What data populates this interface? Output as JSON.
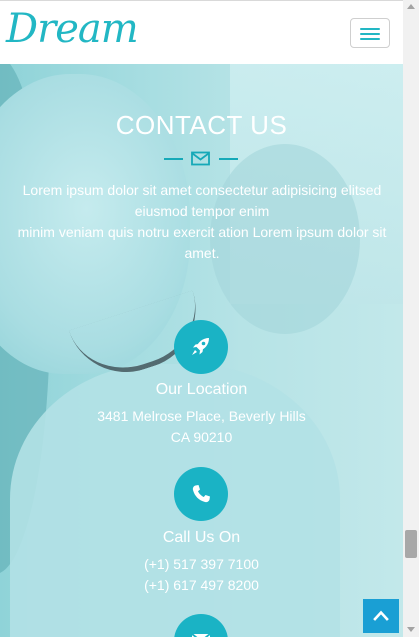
{
  "nav": {
    "brand": "Dream",
    "menu_icon": "hamburger-menu-icon"
  },
  "contact": {
    "title": "CONTACT US",
    "divider_icon": "envelope-icon",
    "lead_line1": "Lorem ipsum dolor sit amet consectetur adipisicing elitsed eiusmod tempor enim",
    "lead_line2": "minim veniam quis notru exercit ation Lorem ipsum dolor sit amet."
  },
  "location": {
    "icon": "rocket-icon",
    "label": "Our Location",
    "address_line1": "3481 Melrose Place, Beverly Hills",
    "address_line2": "CA 90210"
  },
  "phone": {
    "icon": "phone-icon",
    "label": "Call Us On",
    "number1": "(+1) 517 397 7100",
    "number2": "(+1) 617 497 8200"
  },
  "email": {
    "icon": "email-icon"
  },
  "back_to_top": {
    "icon": "chevron-up-icon"
  },
  "colors": {
    "brand": "#22b7c4",
    "accent": "#1ab3c5",
    "overlay": "#a6dde1",
    "back_to_top": "#1a9fd4"
  }
}
